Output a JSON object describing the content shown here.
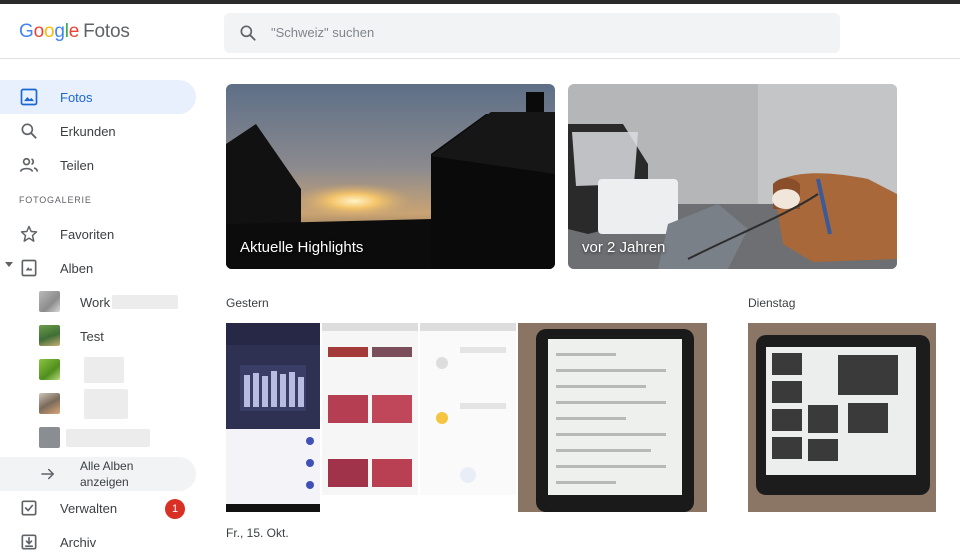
{
  "header": {
    "logo_google": [
      "G",
      "o",
      "o",
      "g",
      "l",
      "e"
    ],
    "logo_product": "Fotos",
    "search_placeholder": "\"Schweiz\" suchen"
  },
  "nav": {
    "items": [
      {
        "label": "Fotos",
        "icon": "photo-icon",
        "active": true
      },
      {
        "label": "Erkunden",
        "icon": "search-icon"
      },
      {
        "label": "Teilen",
        "icon": "people-icon"
      }
    ],
    "section_label": "FOTOGALERIE",
    "favorites": "Favoriten",
    "albums": "Alben",
    "album_list": [
      {
        "label": "Work"
      },
      {
        "label": "Test"
      },
      {
        "label": ""
      },
      {
        "label": ""
      },
      {
        "label": ""
      }
    ],
    "show_all_line1": "Alle Alben",
    "show_all_line2": "anzeigen",
    "manage": "Verwalten",
    "manage_badge": "1",
    "archive": "Archiv"
  },
  "highlights": [
    {
      "caption": "Aktuelle Highlights"
    },
    {
      "caption": "vor 2 Jahren"
    }
  ],
  "groups": [
    {
      "date": "Gestern"
    },
    {
      "date": "Dienstag"
    },
    {
      "date": "Fr., 15. Okt."
    }
  ],
  "colors": {
    "accent": "#1967d2",
    "active_bg": "#e8f0fe",
    "badge": "#d93025"
  }
}
